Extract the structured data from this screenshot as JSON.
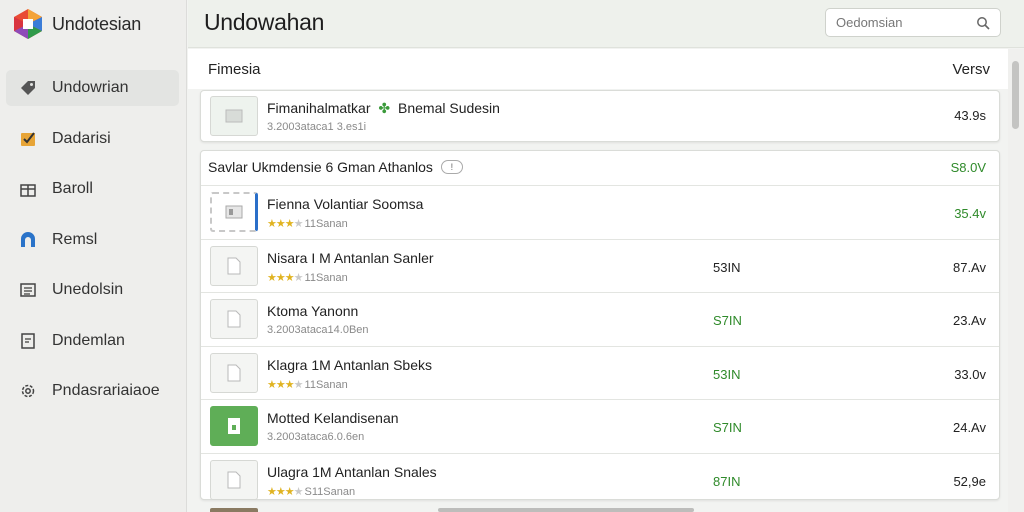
{
  "app": {
    "name": "Undotesian",
    "header_title": "Undowahan"
  },
  "search": {
    "placeholder": "Oedomsian"
  },
  "sidebar": {
    "items": [
      {
        "label": "Undowrian",
        "icon": "tag-icon",
        "active": true
      },
      {
        "label": "Dadarisi",
        "icon": "checkbox-icon",
        "active": false
      },
      {
        "label": "Baroll",
        "icon": "gift-icon",
        "active": false
      },
      {
        "label": "Remsl",
        "icon": "app-icon",
        "active": false
      },
      {
        "label": "Unedolsin",
        "icon": "list-icon",
        "active": false
      },
      {
        "label": "Dndemlan",
        "icon": "document-icon",
        "active": false
      },
      {
        "label": "Pndasrariaiaoe",
        "icon": "gear-icon",
        "active": false
      }
    ]
  },
  "list_header": {
    "left": "Fimesia",
    "right": "Versv"
  },
  "featured": {
    "name": "Fimanihalmatkar",
    "suffix": "Bnemal Sudesin",
    "meta": "3.2003ataca1 3.es1i",
    "value": "43.9s"
  },
  "section": {
    "title": "Savlar Ukmdensie 6 Gman Athanlos",
    "pill": "!",
    "value": "S8.0V"
  },
  "rows": [
    {
      "name": "Fienna Volantiar Soomsa",
      "meta": "11Sanan",
      "rating": 3,
      "mid": "",
      "right": "35.4v",
      "right_green": true,
      "thumb": "dashed"
    },
    {
      "name": "Nisara I M Antanlan Sanler",
      "meta": "11Sanan",
      "rating": 3,
      "mid": "53IN",
      "mid_green": false,
      "right": "87.Av",
      "thumb": "plain"
    },
    {
      "name": "Ktoma Yanonn",
      "meta": "3.2003ataca14.0Ben",
      "rating": 0,
      "mid": "S7IN",
      "mid_green": true,
      "right": "23.Av",
      "thumb": "plain"
    },
    {
      "name": "Klagra 1M Antanlan Sbeks",
      "meta": "11Sanan",
      "rating": 3,
      "mid": "53IN",
      "mid_green": true,
      "right": "33.0v",
      "thumb": "plain"
    },
    {
      "name": "Motted Kelandisenan",
      "meta": "3.2003ataca6.0.6en",
      "rating": 0,
      "mid": "S7IN",
      "mid_green": true,
      "right": "24.Av",
      "thumb": "green"
    },
    {
      "name": "Ulagra 1M Antanlan Snales",
      "meta": "S11Sanan",
      "rating": 3,
      "mid": "87IN",
      "mid_green": true,
      "right": "52,9e",
      "thumb": "plain"
    }
  ],
  "colors": {
    "accent_green": "#2f8a2a",
    "star": "#e0b321",
    "sidebar_bg": "#eeeeec"
  }
}
